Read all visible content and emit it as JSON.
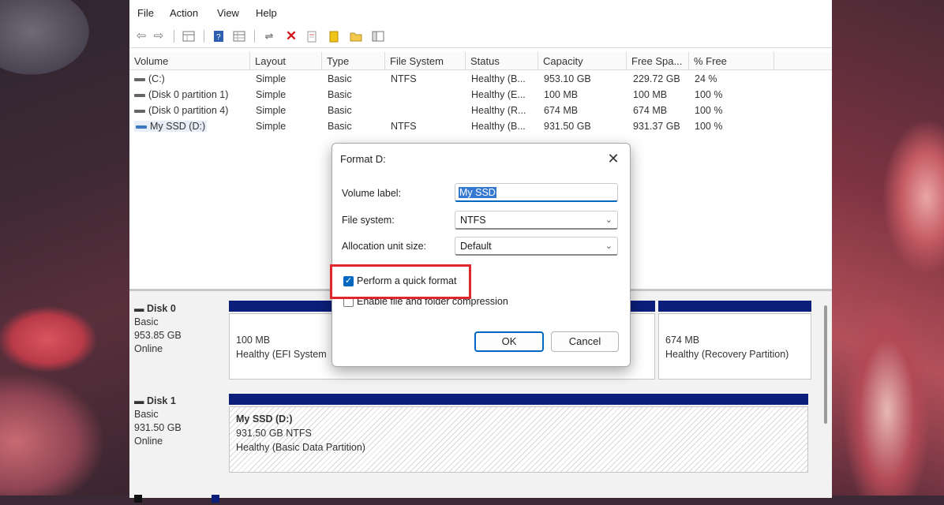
{
  "menu": [
    "File",
    "Action",
    "View",
    "Help"
  ],
  "toolbar_icons": [
    "back-arrow-icon",
    "forward-arrow-icon",
    "disk-list-icon",
    "help-book-icon",
    "properties-grid-icon",
    "connect-icon",
    "delete-x-icon",
    "document-icon",
    "yellow-key-icon",
    "yellow-folder-icon",
    "window-icon"
  ],
  "volume_table": {
    "columns": [
      "Volume",
      "Layout",
      "Type",
      "File System",
      "Status",
      "Capacity",
      "Free Spa...",
      "% Free"
    ],
    "rows": [
      {
        "volume": "(C:)",
        "layout": "Simple",
        "type": "Basic",
        "fs": "NTFS",
        "status": "Healthy (B...",
        "capacity": "953.10 GB",
        "free": "229.72 GB",
        "pct": "24 %"
      },
      {
        "volume": "(Disk 0 partition 1)",
        "layout": "Simple",
        "type": "Basic",
        "fs": "",
        "status": "Healthy (E...",
        "capacity": "100 MB",
        "free": "100 MB",
        "pct": "100 %"
      },
      {
        "volume": "(Disk 0 partition 4)",
        "layout": "Simple",
        "type": "Basic",
        "fs": "",
        "status": "Healthy (R...",
        "capacity": "674 MB",
        "free": "674 MB",
        "pct": "100 %"
      },
      {
        "volume": "My SSD (D:)",
        "layout": "Simple",
        "type": "Basic",
        "fs": "NTFS",
        "status": "Healthy (B...",
        "capacity": "931.50 GB",
        "free": "931.37 GB",
        "pct": "100 %"
      }
    ]
  },
  "disks": [
    {
      "name": "Disk 0",
      "type": "Basic",
      "size": "953.85 GB",
      "status": "Online",
      "partitions": [
        {
          "line1": "100 MB",
          "line2": "Healthy (EFI System"
        },
        {
          "line1": "674 MB",
          "line2": "Healthy (Recovery Partition)"
        }
      ]
    },
    {
      "name": "Disk 1",
      "type": "Basic",
      "size": "931.50 GB",
      "status": "Online",
      "partitions": [
        {
          "title": "My SSD  (D:)",
          "line1": "931.50 GB NTFS",
          "line2": "Healthy (Basic Data Partition)"
        }
      ]
    }
  ],
  "dialog": {
    "title": "Format D:",
    "volume_label_label": "Volume label:",
    "volume_label_value": "My SSD",
    "file_system_label": "File system:",
    "file_system_value": "NTFS",
    "alloc_label": "Allocation unit size:",
    "alloc_value": "Default",
    "quick_format_label": "Perform a quick format",
    "quick_format_checked": true,
    "compression_label": "Enable file and folder compression",
    "compression_checked": false,
    "ok_label": "OK",
    "cancel_label": "Cancel",
    "close_glyph": "✕"
  },
  "colors": {
    "highlight": "#e0262b",
    "partition_strip": "#0b1e7a",
    "accent": "#0067c0"
  }
}
